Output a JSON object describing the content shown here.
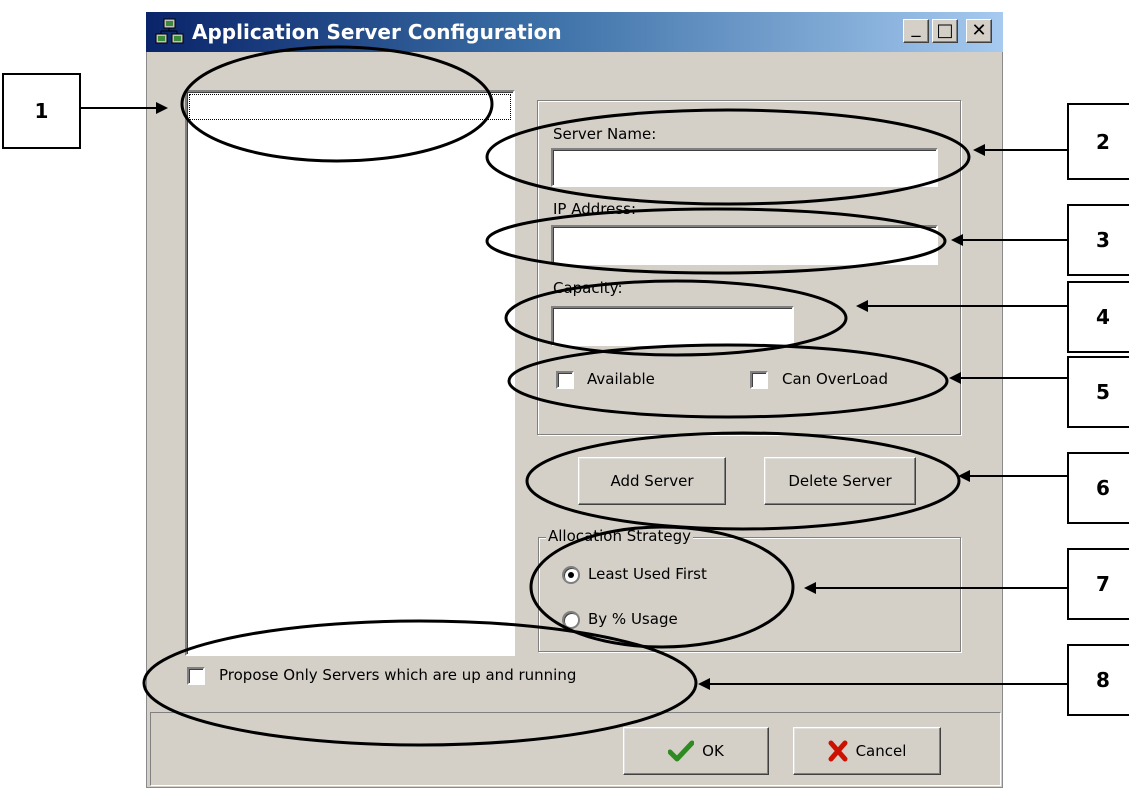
{
  "window": {
    "title": "Application Server Configuration",
    "controls": {
      "minimize": "_",
      "maximize": "□",
      "close": "✕"
    }
  },
  "server_list": {
    "items": []
  },
  "form": {
    "server_name_label": "Server Name:",
    "server_name_value": "",
    "ip_label": "IP Address:",
    "ip_value": "",
    "capacity_label": "Capacity:",
    "capacity_value": "",
    "available_label": "Available",
    "available_checked": false,
    "overload_label": "Can OverLoad",
    "overload_checked": false
  },
  "buttons": {
    "add_server": "Add Server",
    "delete_server": "Delete Server",
    "ok": "OK",
    "cancel": "Cancel"
  },
  "allocation": {
    "legend": "Allocation Strategy",
    "options": [
      {
        "label": "Least Used First",
        "selected": true
      },
      {
        "label": "By % Usage",
        "selected": false
      }
    ]
  },
  "propose_only": {
    "label": "Propose Only Servers which are up and running",
    "checked": false
  },
  "callouts": [
    "1",
    "2",
    "3",
    "4",
    "5",
    "6",
    "7",
    "8"
  ],
  "colors": {
    "dialog_face": "#d4d0c8",
    "title_start": "#0a246a",
    "title_end": "#a6caf0",
    "ok_check": "#2e8b22",
    "cancel_x": "#cc1100"
  }
}
